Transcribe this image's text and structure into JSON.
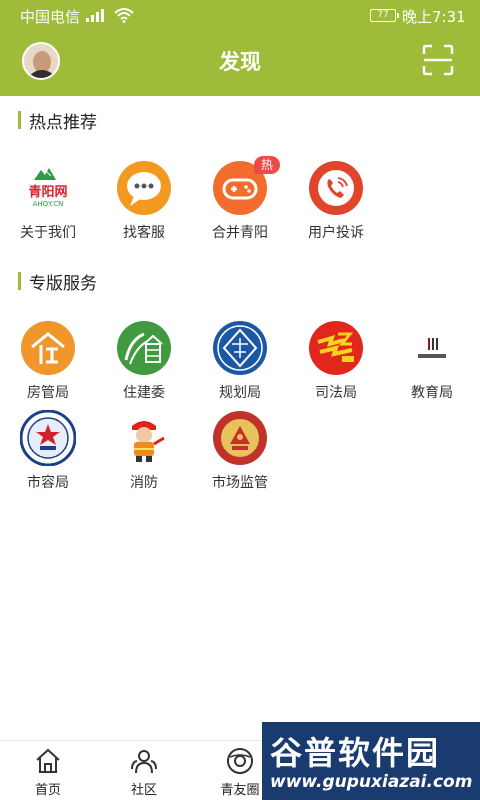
{
  "status_bar": {
    "carrier": "中国电信",
    "battery": "77",
    "time": "晚上7:31"
  },
  "header": {
    "title": "发现"
  },
  "sections": [
    {
      "title": "热点推荐",
      "items": [
        {
          "label": "关于我们",
          "icon": "qingyang-logo-icon",
          "logo_text": "青阳网",
          "logo_sub": "AHQY.CN"
        },
        {
          "label": "找客服",
          "icon": "chat-bubble-icon"
        },
        {
          "label": "合并青阳",
          "icon": "gamepad-icon",
          "badge": "热"
        },
        {
          "label": "用户投诉",
          "icon": "phone-call-icon"
        }
      ]
    },
    {
      "title": "专版服务",
      "items": [
        {
          "label": "房管局",
          "icon": "housing-bureau-icon"
        },
        {
          "label": "住建委",
          "icon": "construction-committee-icon"
        },
        {
          "label": "规划局",
          "icon": "planning-bureau-icon"
        },
        {
          "label": "司法局",
          "icon": "justice-bureau-icon"
        },
        {
          "label": "教育局",
          "icon": "education-bureau-icon"
        },
        {
          "label": "市容局",
          "icon": "city-appearance-icon"
        },
        {
          "label": "消防",
          "icon": "firefighter-icon"
        },
        {
          "label": "市场监管",
          "icon": "market-supervision-icon"
        }
      ]
    }
  ],
  "bottom_nav": [
    {
      "label": "首页",
      "icon": "home-icon"
    },
    {
      "label": "社区",
      "icon": "community-icon"
    },
    {
      "label": "青友圈",
      "icon": "friend-circle-icon"
    }
  ],
  "watermark": {
    "title": "谷普软件园",
    "url": "www.gupuxiazai.com"
  },
  "colors": {
    "accent": "#9fbb3a",
    "hot": "#ef4a4a"
  }
}
